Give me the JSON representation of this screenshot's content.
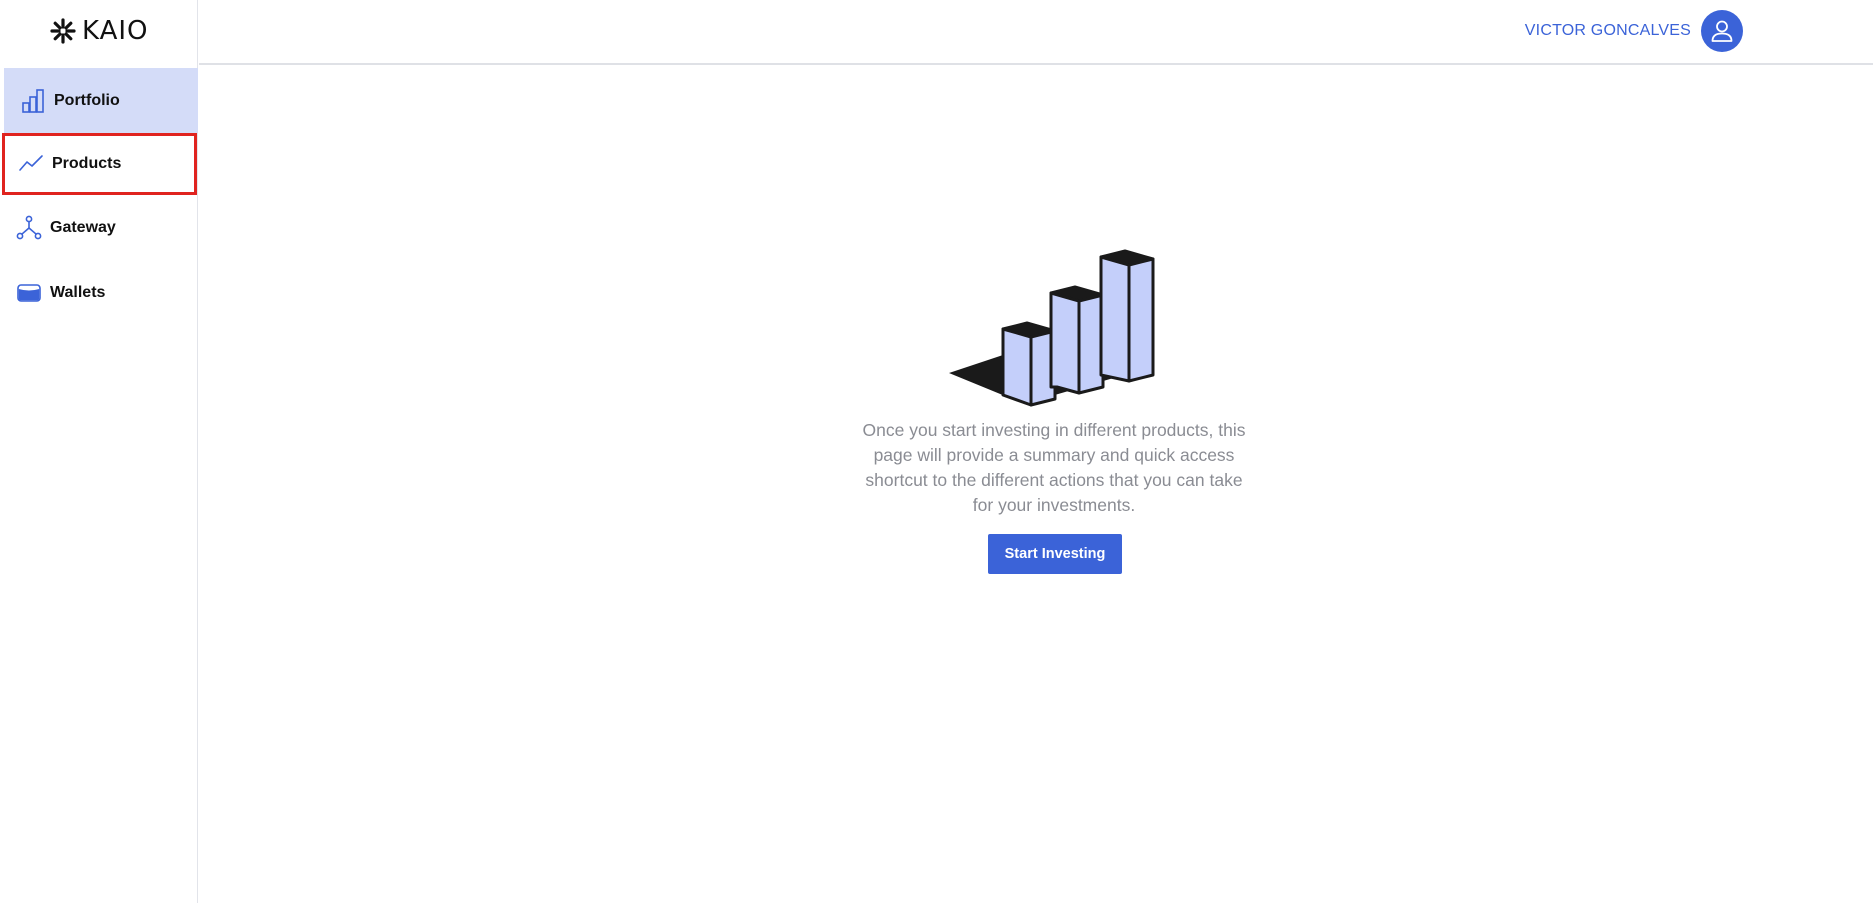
{
  "brand": {
    "name": "KAIO"
  },
  "sidebar": {
    "items": [
      {
        "label": "Portfolio",
        "icon": "bar-chart-icon"
      },
      {
        "label": "Products",
        "icon": "trend-line-icon"
      },
      {
        "label": "Gateway",
        "icon": "network-nodes-icon"
      },
      {
        "label": "Wallets",
        "icon": "wallet-icon"
      }
    ]
  },
  "header": {
    "user_name": "VICTOR GONCALVES",
    "avatar_icon": "user-icon"
  },
  "main": {
    "empty_state_text": "Once you start investing in different products, this page will provide a summary and quick access shortcut to the different actions that you can take for your investments.",
    "cta_label": "Start Investing",
    "illustration_icon": "3d-bar-chart-illustration"
  },
  "colors": {
    "accent": "#3b63d8",
    "active_nav_bg": "#d4dcf8",
    "highlight_border": "#e0231f",
    "bar_fill": "#c4cffa"
  }
}
